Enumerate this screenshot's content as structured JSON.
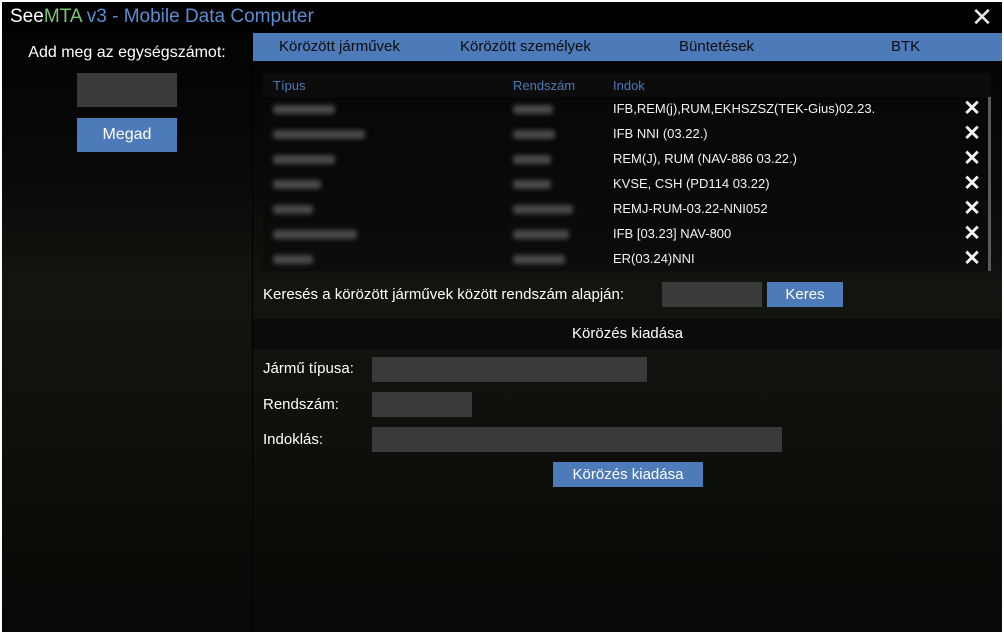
{
  "window": {
    "title_part1": "See",
    "title_part2": "MTA",
    "title_part3": " v3 - Mobile Data Computer",
    "close_glyph": "✕"
  },
  "unit": {
    "label": "Add meg az egységszámot:",
    "input_value": "",
    "submit_label": "Megad"
  },
  "tabs": [
    {
      "label": "Körözött járművek"
    },
    {
      "label": "Körözött személyek"
    },
    {
      "label": "Büntetések"
    },
    {
      "label": "BTK"
    }
  ],
  "list": {
    "headers": {
      "type": "Típus",
      "plate": "Rendszám",
      "reason": "Indok"
    },
    "rows": [
      {
        "type": "",
        "plate": "",
        "reason": "IFB,REM(j),RUM,EKHSZSZ(TEK-Gius)02.23."
      },
      {
        "type": "",
        "plate": "",
        "reason": "IFB NNI (03.22.)"
      },
      {
        "type": "",
        "plate": "",
        "reason": "REM(J), RUM (NAV-886 03.22.)"
      },
      {
        "type": "",
        "plate": "",
        "reason": "KVSE, CSH (PD114 03.22)"
      },
      {
        "type": "",
        "plate": "",
        "reason": "REMJ-RUM-03.22-NNI052"
      },
      {
        "type": "",
        "plate": "",
        "reason": "IFB [03.23] NAV-800"
      },
      {
        "type": "",
        "plate": "",
        "reason": "ER(03.24)NNI"
      }
    ],
    "delete_glyph": "✕"
  },
  "search": {
    "label": "Keresés a körözött járművek között rendszám alapján:",
    "input_value": "",
    "button_label": "Keres"
  },
  "issue": {
    "section_title": "Körözés kiadása",
    "vehicle_type_label": "Jármű típusa:",
    "plate_label": "Rendszám:",
    "reason_label": "Indoklás:",
    "vehicle_type_value": "",
    "plate_value": "",
    "reason_value": "",
    "submit_label": "Körözés kiadása"
  },
  "colors": {
    "accent": "#4d7ab8",
    "title_green": "#7cc576",
    "title_blue": "#5a8ed2",
    "input_bg": "#3a3a3a"
  }
}
